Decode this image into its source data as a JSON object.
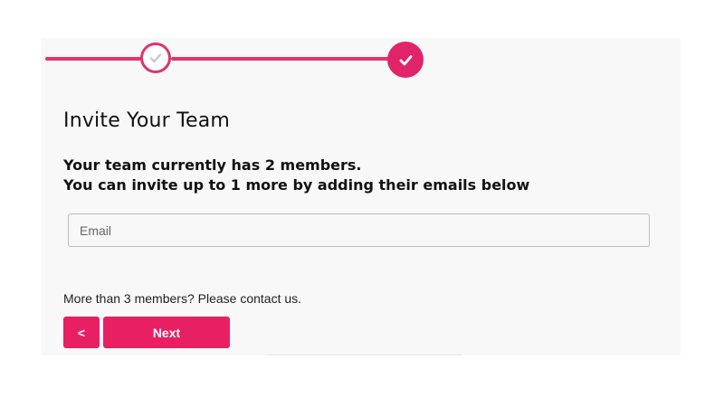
{
  "stepper": {
    "steps": [
      {
        "state": "completed",
        "icon": "check-icon"
      },
      {
        "state": "active",
        "icon": "check-icon"
      }
    ],
    "accent_color": "#e1236a"
  },
  "form": {
    "title": "Invite Your Team",
    "subtitle_line1": "Your team currently has 2 members.",
    "subtitle_line2": "You can invite up to 1 more by adding their emails below",
    "email": {
      "placeholder": "Email",
      "value": ""
    },
    "contact_note": "More than 3 members? Please contact us.",
    "back_label": "<",
    "next_label": "Next"
  }
}
